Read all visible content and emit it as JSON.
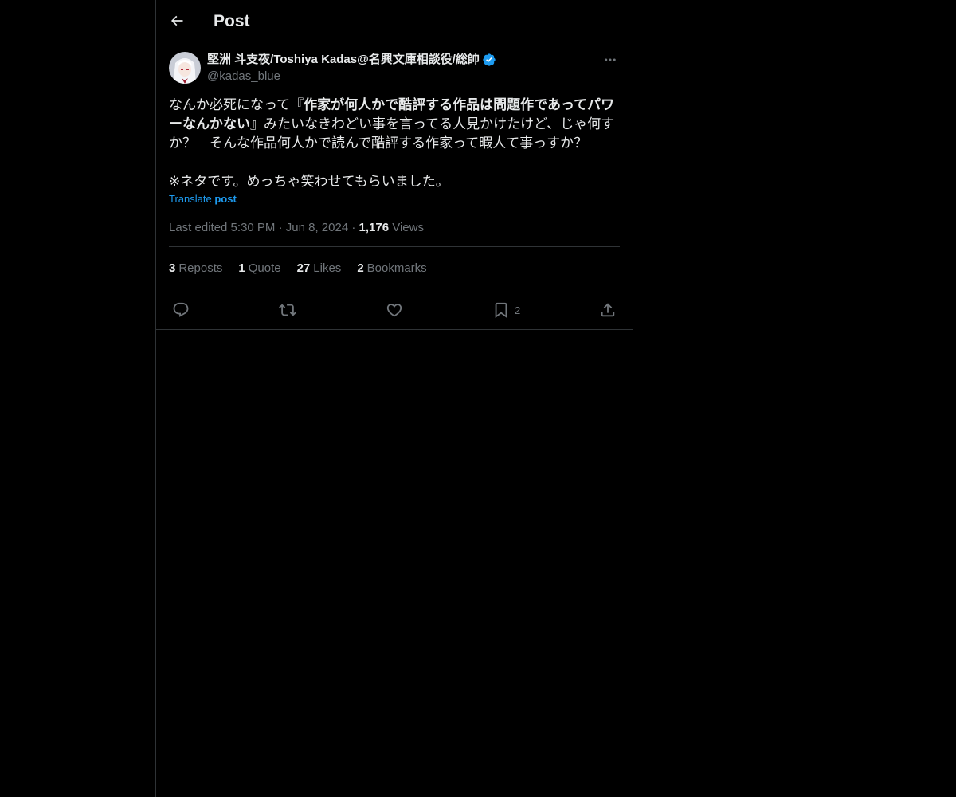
{
  "header": {
    "title": "Post"
  },
  "post": {
    "author": {
      "display_name": "堅洲 斗支夜/Toshiya Kadas@名興文庫相談役/総帥",
      "handle": "@kadas_blue",
      "verified": true
    },
    "text": {
      "part1": "なんか必死になって『",
      "part2_bold": "作家が何人かで酷評する作品は問題作であってパワーなんかない",
      "part3": "』みたいなきわどい事を言ってる人見かけたけど、じゃ何すか？　そんな作品何人かで読んで酷評する作家って暇人て事っすか？\n\n※ネタです。めっちゃ笑わせてもらいました。"
    },
    "translate": {
      "prefix": "Translate ",
      "suffix": "post"
    },
    "meta": {
      "edited_label": "Last edited 5:30 PM",
      "date": "Jun 8, 2024",
      "separator": "·",
      "views_count": "1,176",
      "views_label": "Views"
    },
    "stats": [
      {
        "count": "3",
        "label": "Reposts"
      },
      {
        "count": "1",
        "label": "Quote"
      },
      {
        "count": "27",
        "label": "Likes"
      },
      {
        "count": "2",
        "label": "Bookmarks"
      }
    ],
    "actions": {
      "reply_icon": "reply-icon",
      "repost_icon": "repost-icon",
      "like_icon": "heart-icon",
      "bookmark_icon": "bookmark-icon",
      "bookmark_count": "2",
      "share_icon": "share-icon"
    }
  },
  "colors": {
    "background": "#000000",
    "text_primary": "#e7e9ea",
    "text_secondary": "#71767b",
    "accent": "#1d9bf0",
    "border": "#2f3336"
  }
}
